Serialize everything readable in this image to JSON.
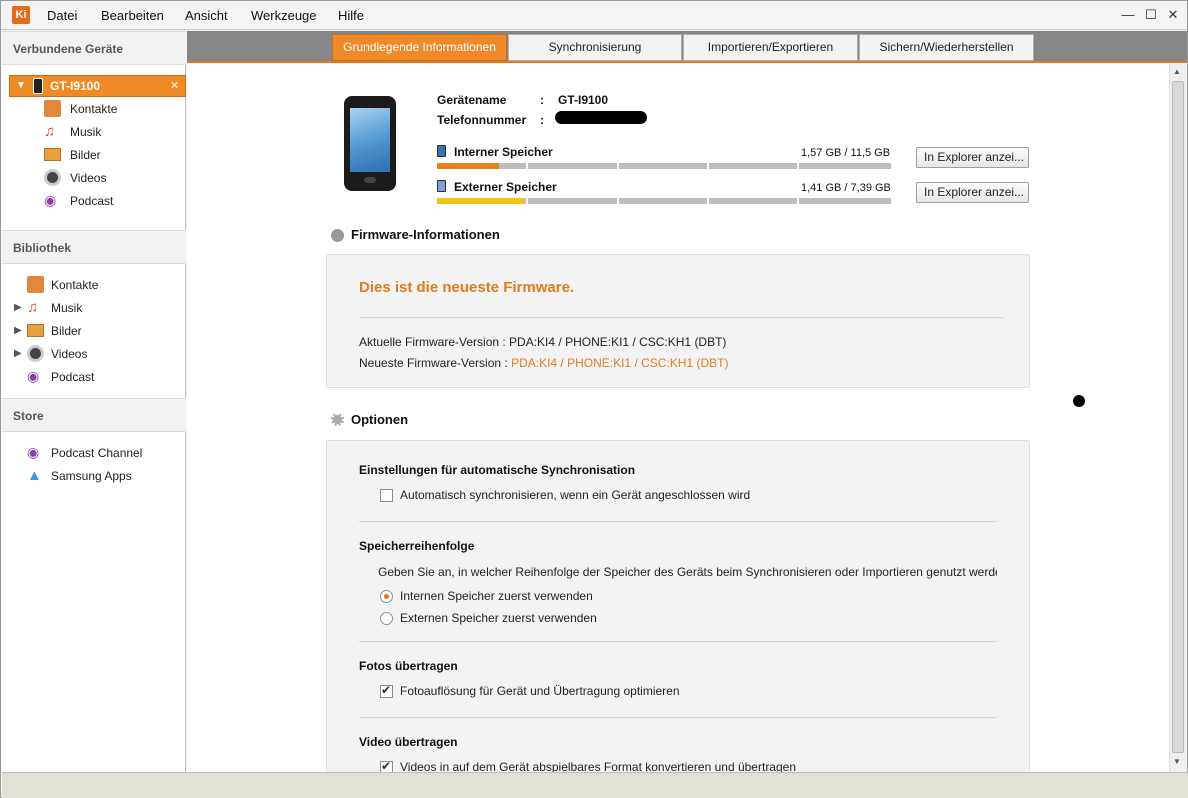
{
  "app": {
    "icon_text": "Ki"
  },
  "menu": [
    "Datei",
    "Bearbeiten",
    "Ansicht",
    "Werkzeuge",
    "Hilfe"
  ],
  "window_controls": {
    "minimize": "—",
    "maximize": "☐",
    "close": "✕"
  },
  "sidebar": {
    "connected_title": "Verbundene Geräte",
    "device": {
      "name": "GT-I9100",
      "close": "✕"
    },
    "device_items": [
      "Kontakte",
      "Musik",
      "Bilder",
      "Videos",
      "Podcast"
    ],
    "library_title": "Bibliothek",
    "library_items": [
      "Kontakte",
      "Musik",
      "Bilder",
      "Videos",
      "Podcast"
    ],
    "store_title": "Store",
    "store_items": [
      "Podcast Channel",
      "Samsung Apps"
    ]
  },
  "tabs": [
    {
      "label": "Grundlegende Informationen",
      "active": true
    },
    {
      "label": "Synchronisierung",
      "active": false
    },
    {
      "label": "Importieren/Exportieren",
      "active": false
    },
    {
      "label": "Sichern/Wiederherstellen",
      "active": false
    }
  ],
  "device_info": {
    "name_label": "Gerätename",
    "name_sep": ":",
    "name_value": "GT-I9100",
    "phone_label": "Telefonnummer",
    "phone_sep": ":"
  },
  "storage": {
    "internal": {
      "label": "Interner Speicher",
      "value": "1,57 GB / 11,5 GB",
      "fill": 0.137,
      "color": "#e8801c",
      "button": "In Explorer anzei..."
    },
    "external": {
      "label": "Externer Speicher",
      "value": "1,41 GB / 7,39 GB",
      "fill": 0.191,
      "color": "#f3c316",
      "button": "In Explorer anzei..."
    }
  },
  "firmware": {
    "title": "Firmware-Informationen",
    "status": "Dies ist die neueste Firmware.",
    "current_label": "Aktuelle Firmware-Version : ",
    "current_value": "PDA:KI4 / PHONE:KI1 / CSC:KH1 (DBT)",
    "latest_label": "Neueste Firmware-Version : ",
    "latest_value": "PDA:KI4 / PHONE:KI1 / CSC:KH1 (DBT)"
  },
  "options": {
    "title": "Optionen",
    "autosync_head": "Einstellungen für automatische Synchronisation",
    "autosync_check": "Automatisch synchronisieren, wenn ein Gerät angeschlossen wird",
    "storage_order_head": "Speicherreihenfolge",
    "storage_order_desc": "Geben Sie an, in welcher Reihenfolge der Speicher des Geräts beim Synchronisieren oder Importieren genutzt werder",
    "radio_internal": "Internen Speicher zuerst verwenden",
    "radio_external": "Externen Speicher zuerst verwenden",
    "photos_head": "Fotos übertragen",
    "photos_check": "Fotoauflösung für Gerät und Übertragung optimieren",
    "video_head": "Video übertragen",
    "video_check": "Videos in auf dem Gerät abspielbares Format konvertieren und übertragen"
  }
}
